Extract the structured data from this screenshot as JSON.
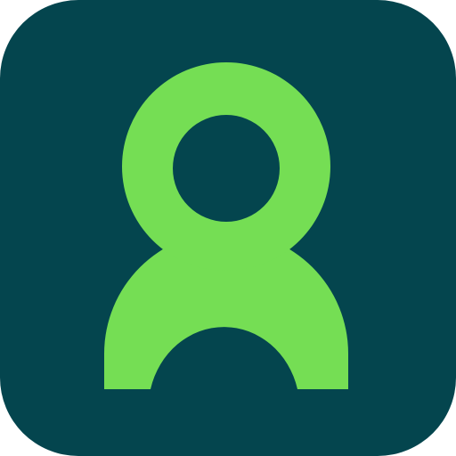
{
  "icon": {
    "name": "person-outline-icon",
    "colors": {
      "background": "#04454E",
      "glyph": "#75DE54"
    }
  }
}
